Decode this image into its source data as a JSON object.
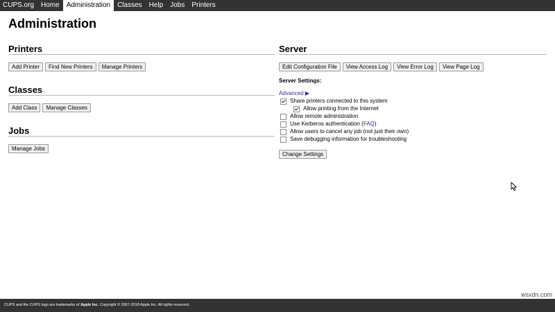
{
  "nav": {
    "items": [
      {
        "label": "CUPS.org",
        "active": false
      },
      {
        "label": "Home",
        "active": false
      },
      {
        "label": "Administration",
        "active": true
      },
      {
        "label": "Classes",
        "active": false
      },
      {
        "label": "Help",
        "active": false
      },
      {
        "label": "Jobs",
        "active": false
      },
      {
        "label": "Printers",
        "active": false
      }
    ]
  },
  "page": {
    "title": "Administration"
  },
  "printers": {
    "heading": "Printers",
    "buttons": [
      "Add Printer",
      "Find New Printers",
      "Manage Printers"
    ]
  },
  "classes": {
    "heading": "Classes",
    "buttons": [
      "Add Class",
      "Manage Classes"
    ]
  },
  "jobs": {
    "heading": "Jobs",
    "buttons": [
      "Manage Jobs"
    ]
  },
  "server": {
    "heading": "Server",
    "buttons": [
      "Edit Configuration File",
      "View Access Log",
      "View Error Log",
      "View Page Log"
    ],
    "settings_heading": "Server Settings:",
    "advanced_label": "Advanced ▶",
    "options": [
      {
        "label": "Share printers connected to this system",
        "checked": true
      },
      {
        "label": "Allow printing from the Internet",
        "checked": true
      },
      {
        "label": "Allow remote administration",
        "checked": false
      },
      {
        "label": "Use Kerberos authentication (",
        "link": "FAQ",
        "suffix": ")",
        "checked": false
      },
      {
        "label": "Allow users to cancel any job (not just their own)",
        "checked": false
      },
      {
        "label": "Save debugging information for troubleshooting",
        "checked": false
      }
    ],
    "change_button": "Change Settings"
  },
  "footer": {
    "text_before": "CUPS and the CUPS logo are trademarks of ",
    "brand": "Apple Inc.",
    "text_after": " Copyright © 2007-2018 Apple Inc. All rights reserved."
  },
  "watermark": "wsxdn.com"
}
